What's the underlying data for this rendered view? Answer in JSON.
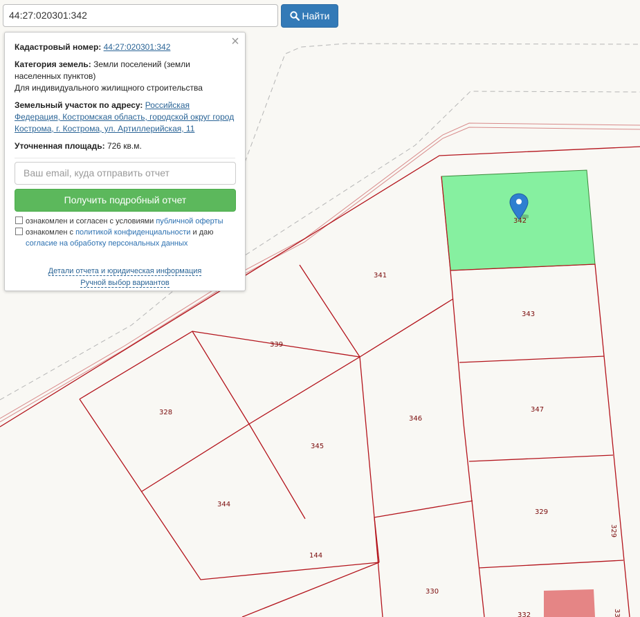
{
  "search": {
    "value": "44:27:020301:342",
    "button_label": "Найти"
  },
  "info": {
    "cadastral_label": "Кадастровый номер:",
    "cadastral_number": "44:27:020301:342",
    "category_label": "Категория земель:",
    "category_value": "Земли поселений (земли населенных пунктов)",
    "usage": "Для индивидуального жилищного строительства",
    "address_label": "Земельный участок по адресу:",
    "address_value": "Российская Федерация, Костромская область, городской округ город Кострома, г. Кострома, ул. Артиллерийская, 11",
    "area_label": "Уточненная площадь:",
    "area_value": "726 кв.м.",
    "email_placeholder": "Ваш email, куда отправить отчет",
    "report_button": "Получить подробный отчет",
    "consent1_text": "ознакомлен и согласен с условиями ",
    "consent1_link": "публичной оферты",
    "consent2_text": "ознакомлен с ",
    "consent2_link": "политикой конфиденциальности",
    "consent2_mid": " и даю ",
    "consent2_link2": "согласие на обработку персональных данных",
    "details_link": "Детали отчета и юридическая информация",
    "manual_link": "Ручной выбор вариантов"
  },
  "map": {
    "parcels": [
      "342",
      "341",
      "343",
      "339",
      "328",
      "345",
      "346",
      "347",
      "344",
      "329",
      "144",
      "330",
      "329",
      "332",
      "33"
    ],
    "selected_parcel": "342",
    "colors": {
      "selected": "#86f0a0",
      "boundary": "#b3131b",
      "highlight": "#e58585"
    }
  }
}
